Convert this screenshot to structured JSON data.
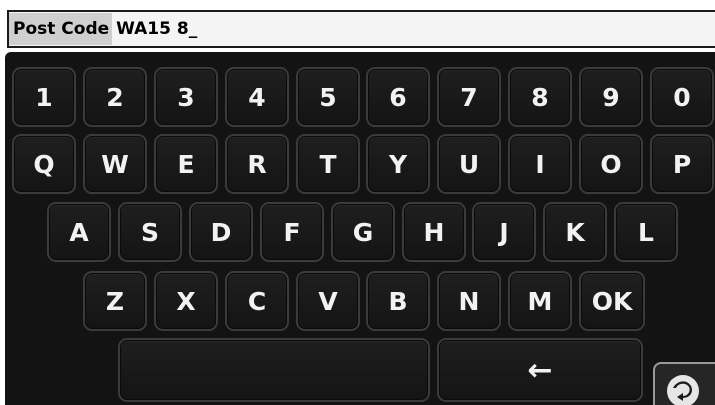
{
  "entry": {
    "label": "Post Code",
    "value": "WA15 8_"
  },
  "keyboard": {
    "row1": [
      "1",
      "2",
      "3",
      "4",
      "5",
      "6",
      "7",
      "8",
      "9",
      "0"
    ],
    "row2": [
      "Q",
      "W",
      "E",
      "R",
      "T",
      "Y",
      "U",
      "I",
      "O",
      "P"
    ],
    "row3": [
      "A",
      "S",
      "D",
      "F",
      "G",
      "H",
      "J",
      "K",
      "L"
    ],
    "row4": [
      "Z",
      "X",
      "C",
      "V",
      "B",
      "N",
      "M"
    ],
    "ok_label": "OK",
    "space_label": "",
    "backspace_label": "←"
  },
  "corner_button": {
    "icon": "back-arrow-icon"
  }
}
